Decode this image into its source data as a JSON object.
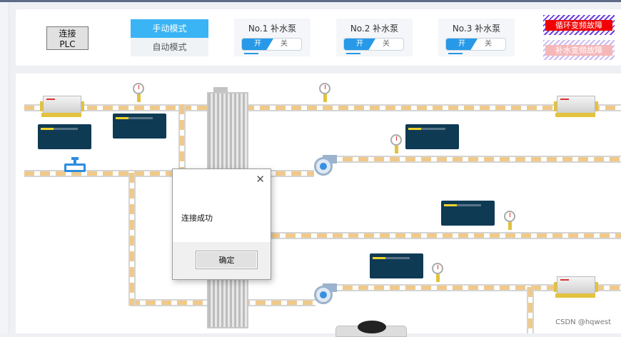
{
  "toolbar": {
    "connect_label": "连接PLC",
    "mode_manual": "手动模式",
    "mode_auto": "自动模式",
    "pumps": [
      {
        "title": "No.1 补水泵",
        "on": "开",
        "off": "关"
      },
      {
        "title": "No.2 补水泵",
        "on": "开",
        "off": "关"
      },
      {
        "title": "No.3 补水泵",
        "on": "开",
        "off": "关"
      }
    ],
    "fault_circulation": "循环变频故障",
    "fault_makeup": "补水变频故障"
  },
  "displays": [
    {
      "fill": 0.35
    },
    {
      "fill": 0.35
    },
    {
      "fill": 0.35
    },
    {
      "fill": 0.35
    },
    {
      "fill": 0.35
    }
  ],
  "dialog": {
    "message": "连接成功",
    "ok_label": "确定",
    "close_glyph": "✕"
  },
  "watermark": "CSDN @hqwest",
  "colors": {
    "accent": "#3ab4f4",
    "switch_on": "#2799e8",
    "fault_red": "#f00000",
    "display_bg": "#0f3a54",
    "display_fill": "#f1d32a"
  }
}
